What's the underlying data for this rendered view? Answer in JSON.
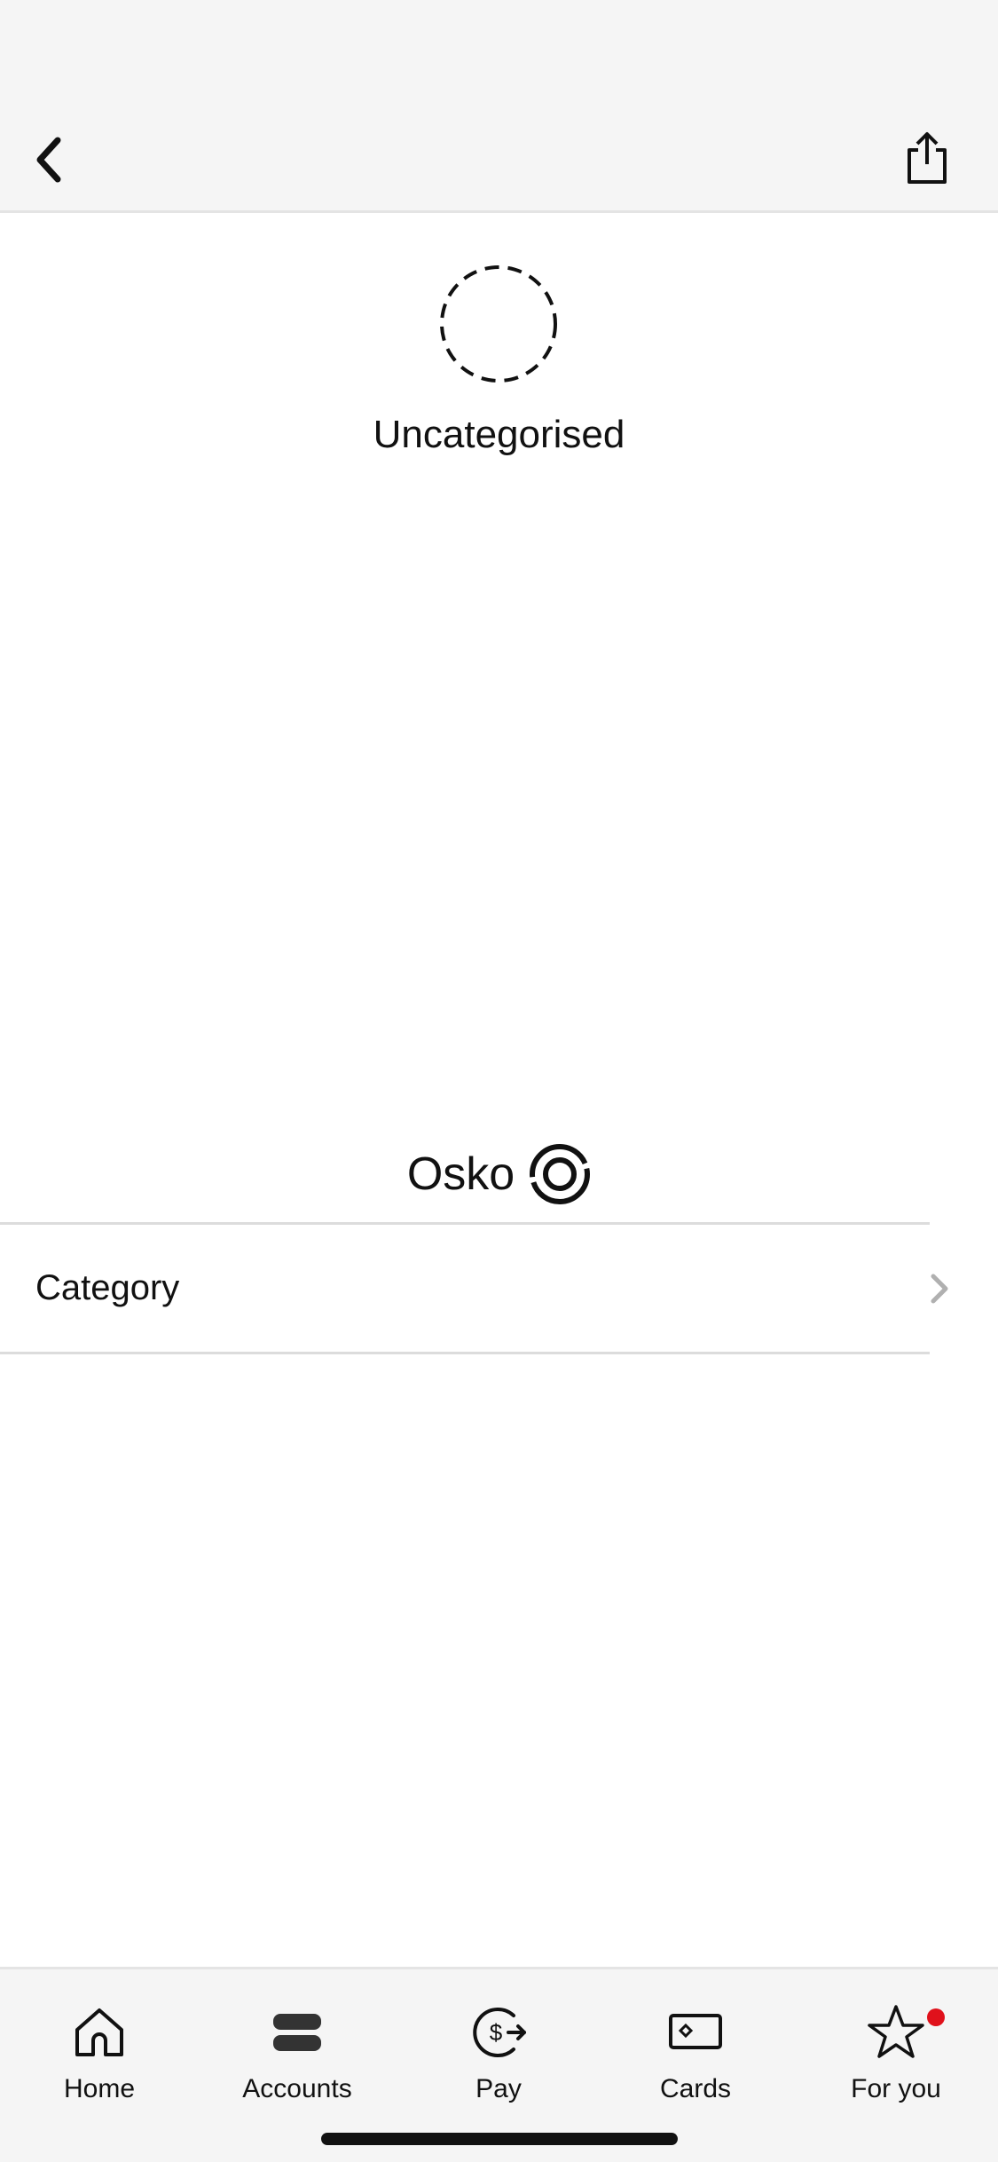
{
  "header": {
    "back_icon": "chevron-left-icon",
    "share_icon": "share-icon"
  },
  "category_hero": {
    "icon": "dashed-circle-icon",
    "title": "Uncategorised"
  },
  "payment_method": {
    "label": "Osko",
    "icon": "osko-logo-icon"
  },
  "details": {
    "category_label": "Category",
    "chevron_icon": "chevron-right-icon"
  },
  "tabbar": {
    "items": [
      {
        "label": "Home",
        "icon": "home-icon"
      },
      {
        "label": "Accounts",
        "icon": "accounts-icon"
      },
      {
        "label": "Pay",
        "icon": "pay-icon"
      },
      {
        "label": "Cards",
        "icon": "card-icon"
      },
      {
        "label": "For you",
        "icon": "star-icon",
        "has_notification": true
      }
    ]
  },
  "colors": {
    "header_bg": "#f5f5f5",
    "badge": "#e0111b",
    "divider": "#dcdcdc",
    "chevron": "#b0b0b0"
  }
}
